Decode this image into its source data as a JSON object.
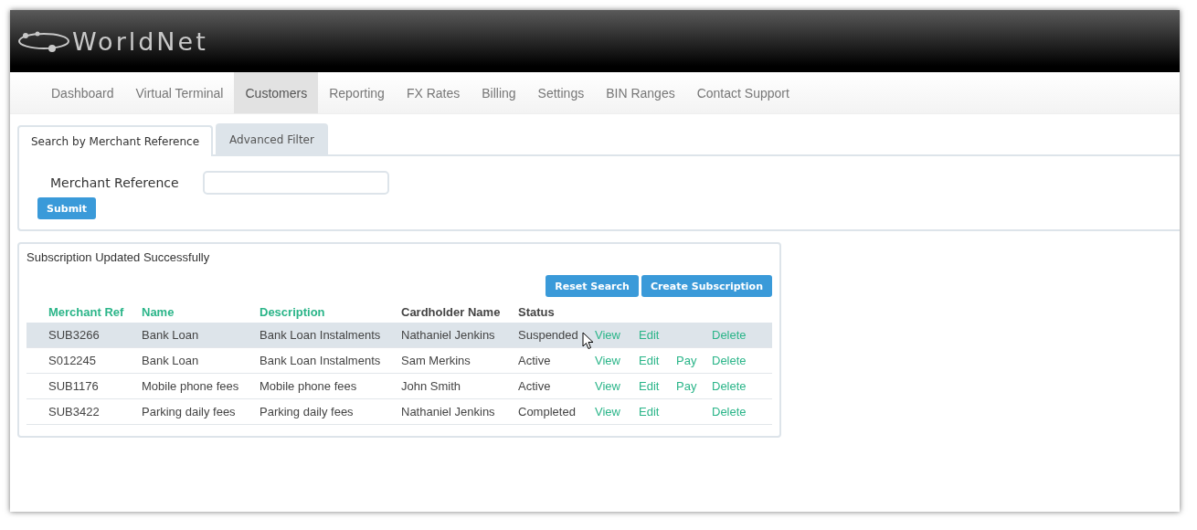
{
  "header": {
    "logo": "WorldNet"
  },
  "nav": [
    {
      "label": "Dashboard",
      "selected": false
    },
    {
      "label": "Virtual Terminal",
      "selected": false
    },
    {
      "label": "Customers",
      "selected": true
    },
    {
      "label": "Reporting",
      "selected": false
    },
    {
      "label": "FX Rates",
      "selected": false
    },
    {
      "label": "Billing",
      "selected": false
    },
    {
      "label": "Settings",
      "selected": false
    },
    {
      "label": "BIN Ranges",
      "selected": false
    },
    {
      "label": "Contact Support",
      "selected": false
    }
  ],
  "search_tabs": [
    {
      "label": "Search by Merchant Reference",
      "selected": true
    },
    {
      "label": "Advanced Filter",
      "selected": false
    }
  ],
  "search": {
    "label": "Merchant Reference",
    "submit": "Submit"
  },
  "results": {
    "message": "Subscription Updated Successfully",
    "buttons": [
      "Reset Search",
      "Create Subscription"
    ],
    "columns": [
      {
        "label": "Merchant Ref",
        "sortable": true
      },
      {
        "label": "Name",
        "sortable": true
      },
      {
        "label": "Description",
        "sortable": true
      },
      {
        "label": "Cardholder Name",
        "sortable": false
      },
      {
        "label": "Status",
        "sortable": false
      }
    ],
    "rows": [
      {
        "cells": [
          "SUB3266",
          "Bank Loan",
          "Bank Loan Instalments",
          "Nathaniel Jenkins",
          "Suspended"
        ],
        "selected": true,
        "actions": [
          {
            "kind": "view",
            "label": "View"
          },
          {
            "kind": "edit",
            "label": "Edit"
          },
          {
            "kind": "delete",
            "label": "Delete"
          }
        ]
      },
      {
        "cells": [
          "S012245",
          "Bank Loan",
          "Bank Loan Instalments",
          "Sam Merkins",
          "Active"
        ],
        "selected": false,
        "actions": [
          {
            "kind": "view",
            "label": "View"
          },
          {
            "kind": "edit",
            "label": "Edit"
          },
          {
            "kind": "pay",
            "label": "Pay"
          },
          {
            "kind": "delete",
            "label": "Delete"
          }
        ]
      },
      {
        "cells": [
          "SUB1176",
          "Mobile phone fees",
          "Mobile phone fees",
          "John Smith",
          "Active"
        ],
        "selected": false,
        "actions": [
          {
            "kind": "view",
            "label": "View"
          },
          {
            "kind": "edit",
            "label": "Edit"
          },
          {
            "kind": "pay",
            "label": "Pay"
          },
          {
            "kind": "delete",
            "label": "Delete"
          }
        ]
      },
      {
        "cells": [
          "SUB3422",
          "Parking daily fees",
          "Parking daily fees",
          "Nathaniel Jenkins",
          "Completed"
        ],
        "selected": false,
        "actions": [
          {
            "kind": "view",
            "label": "View"
          },
          {
            "kind": "edit",
            "label": "Edit"
          },
          {
            "kind": "delete",
            "label": "Delete"
          }
        ]
      }
    ]
  }
}
